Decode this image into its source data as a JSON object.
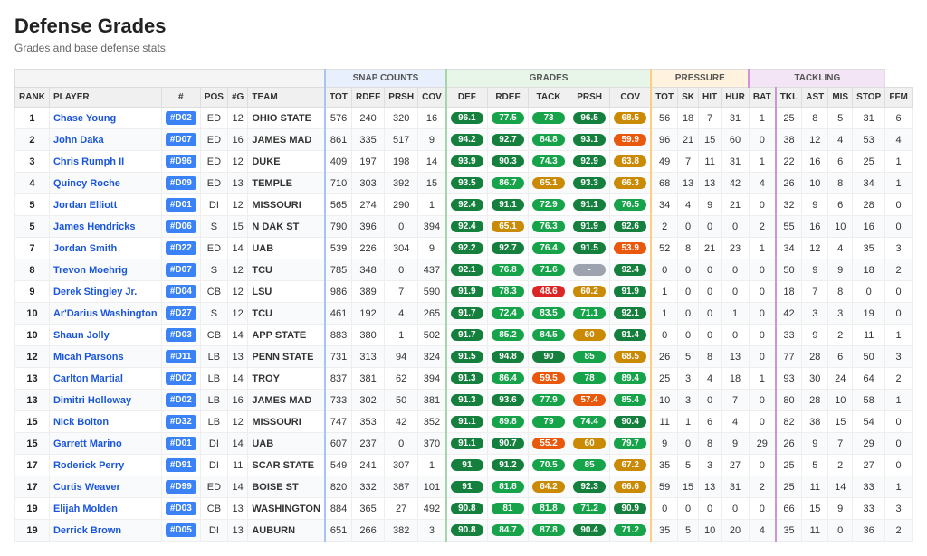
{
  "title": "Defense Grades",
  "subtitle": "Grades and base defense stats.",
  "group_headers": [
    {
      "label": "",
      "colspan": 5,
      "key": "empty1"
    },
    {
      "label": "SNAP COUNTS",
      "colspan": 4,
      "key": "snap"
    },
    {
      "label": "GRADES",
      "colspan": 5,
      "key": "grades"
    },
    {
      "label": "PRESSURE",
      "colspan": 4,
      "key": "pressure"
    },
    {
      "label": "TACKLING",
      "colspan": 5,
      "key": "tackling"
    }
  ],
  "col_headers": [
    "RANK",
    "PLAYER",
    "#",
    "POS",
    "#G",
    "TEAM",
    "TOT",
    "RDEF",
    "PRSH",
    "COV",
    "DEF",
    "RDEF",
    "TACK",
    "PRSH",
    "COV",
    "TOT",
    "SK",
    "HIT",
    "HUR",
    "BAT",
    "TKL",
    "AST",
    "MIS",
    "STOP",
    "FFM"
  ],
  "rows": [
    {
      "rank": 1,
      "player": "Chase Young",
      "num": "#D02",
      "pos": "ED",
      "g": 12,
      "team": "OHIO STATE",
      "tot": 576,
      "rdef": 240,
      "prsh": 320,
      "cov": 16,
      "def": 96.1,
      "def_c": "g-green-dark",
      "rdef_g": 77.5,
      "rdef_c": "g-green",
      "tack_g": 73.0,
      "tack_c": "g-green",
      "prsh_g": 96.5,
      "prsh_c": "g-green-dark",
      "cov_g": 68.5,
      "cov_c": "g-yellow",
      "ptot": 56,
      "sk": 18,
      "hit": 7,
      "hur": 31,
      "bat": 1,
      "tkl": 25,
      "ast": 8,
      "mis": 5,
      "stop": 31,
      "ffm": 6
    },
    {
      "rank": 2,
      "player": "John Daka",
      "num": "#D07",
      "pos": "ED",
      "g": 16,
      "team": "JAMES MAD",
      "tot": 861,
      "rdef": 335,
      "prsh": 517,
      "cov": 9,
      "def": 94.2,
      "def_c": "g-green-dark",
      "rdef_g": 92.7,
      "rdef_c": "g-green-dark",
      "tack_g": 84.8,
      "tack_c": "g-green",
      "prsh_g": 93.1,
      "prsh_c": "g-green-dark",
      "cov_g": 59.9,
      "cov_c": "g-orange",
      "ptot": 96,
      "sk": 21,
      "hit": 15,
      "hur": 60,
      "bat": 0,
      "tkl": 38,
      "ast": 12,
      "mis": 4,
      "stop": 53,
      "ffm": 4
    },
    {
      "rank": 3,
      "player": "Chris Rumph II",
      "num": "#D96",
      "pos": "ED",
      "g": 12,
      "team": "DUKE",
      "tot": 409,
      "rdef": 197,
      "prsh": 198,
      "cov": 14,
      "def": 93.9,
      "def_c": "g-green-dark",
      "rdef_g": 90.3,
      "rdef_c": "g-green-dark",
      "tack_g": 74.3,
      "tack_c": "g-green",
      "prsh_g": 92.9,
      "prsh_c": "g-green-dark",
      "cov_g": 63.8,
      "cov_c": "g-yellow",
      "ptot": 49,
      "sk": 7,
      "hit": 11,
      "hur": 31,
      "bat": 1,
      "tkl": 22,
      "ast": 16,
      "mis": 6,
      "stop": 25,
      "ffm": 1
    },
    {
      "rank": 4,
      "player": "Quincy Roche",
      "num": "#D09",
      "pos": "ED",
      "g": 13,
      "team": "TEMPLE",
      "tot": 710,
      "rdef": 303,
      "prsh": 392,
      "cov": 15,
      "def": 93.5,
      "def_c": "g-green-dark",
      "rdef_g": 86.7,
      "rdef_c": "g-green",
      "tack_g": 65.1,
      "tack_c": "g-yellow",
      "prsh_g": 93.3,
      "prsh_c": "g-green-dark",
      "cov_g": 66.3,
      "cov_c": "g-yellow",
      "ptot": 68,
      "sk": 13,
      "hit": 13,
      "hur": 42,
      "bat": 4,
      "tkl": 26,
      "ast": 10,
      "mis": 8,
      "stop": 34,
      "ffm": 1
    },
    {
      "rank": 5,
      "player": "Jordan Elliott",
      "num": "#D01",
      "pos": "DI",
      "g": 12,
      "team": "MISSOURI",
      "tot": 565,
      "rdef": 274,
      "prsh": 290,
      "cov": 1,
      "def": 92.4,
      "def_c": "g-green-dark",
      "rdef_g": 91.1,
      "rdef_c": "g-green-dark",
      "tack_g": 72.9,
      "tack_c": "g-green",
      "prsh_g": 91.1,
      "prsh_c": "g-green-dark",
      "cov_g": 76.5,
      "cov_c": "g-green",
      "ptot": 34,
      "sk": 4,
      "hit": 9,
      "hur": 21,
      "bat": 0,
      "tkl": 32,
      "ast": 9,
      "mis": 6,
      "stop": 28,
      "ffm": 0
    },
    {
      "rank": 5,
      "player": "James Hendricks",
      "num": "#D06",
      "pos": "S",
      "g": 15,
      "team": "N DAK ST",
      "tot": 790,
      "rdef": 396,
      "prsh": 0,
      "cov": 394,
      "def": 92.4,
      "def_c": "g-green-dark",
      "rdef_g": 65.1,
      "rdef_c": "g-yellow",
      "tack_g": 76.3,
      "tack_c": "g-green",
      "prsh_g": 91.9,
      "prsh_c": "g-green-dark",
      "cov_g": 92.6,
      "cov_c": "g-green-dark",
      "ptot": 2,
      "sk": 0,
      "hit": 0,
      "hur": 0,
      "bat": 2,
      "tkl": 55,
      "ast": 16,
      "mis": 10,
      "stop": 16,
      "ffm": 0
    },
    {
      "rank": 7,
      "player": "Jordan Smith",
      "num": "#D22",
      "pos": "ED",
      "g": 14,
      "team": "UAB",
      "tot": 539,
      "rdef": 226,
      "prsh": 304,
      "cov": 9,
      "def": 92.2,
      "def_c": "g-green-dark",
      "rdef_g": 92.7,
      "rdef_c": "g-green-dark",
      "tack_g": 76.4,
      "tack_c": "g-green",
      "prsh_g": 91.5,
      "prsh_c": "g-green-dark",
      "cov_g": 53.9,
      "cov_c": "g-orange",
      "ptot": 52,
      "sk": 8,
      "hit": 21,
      "hur": 23,
      "bat": 1,
      "tkl": 34,
      "ast": 12,
      "mis": 4,
      "stop": 35,
      "ffm": 3
    },
    {
      "rank": 8,
      "player": "Trevon Moehrig",
      "num": "#D07",
      "pos": "S",
      "g": 12,
      "team": "TCU",
      "tot": 785,
      "rdef": 348,
      "prsh": 0,
      "cov": 437,
      "def": 92.1,
      "def_c": "g-green-dark",
      "rdef_g": 76.8,
      "rdef_c": "g-green",
      "tack_g": 71.6,
      "tack_c": "g-green",
      "prsh_g": "-",
      "prsh_c": "g-gray",
      "cov_g": 92.4,
      "cov_c": "g-green-dark",
      "ptot": 0,
      "sk": 0,
      "hit": 0,
      "hur": 0,
      "bat": 0,
      "tkl": 50,
      "ast": 9,
      "mis": 9,
      "stop": 18,
      "ffm": 2
    },
    {
      "rank": 9,
      "player": "Derek Stingley Jr.",
      "num": "#D04",
      "pos": "CB",
      "g": 12,
      "team": "LSU",
      "tot": 986,
      "rdef": 389,
      "prsh": 7,
      "cov": 590,
      "def": 91.9,
      "def_c": "g-green-dark",
      "rdef_g": 78.3,
      "rdef_c": "g-green",
      "tack_g": 48.6,
      "tack_c": "g-red",
      "prsh_g": 60.2,
      "prsh_c": "g-yellow",
      "cov_g": 91.9,
      "cov_c": "g-green-dark",
      "ptot": 1,
      "sk": 0,
      "hit": 0,
      "hur": 0,
      "bat": 0,
      "tkl": 18,
      "ast": 7,
      "mis": 8,
      "stop": 0,
      "ffm": 0
    },
    {
      "rank": 10,
      "player": "Ar'Darius Washington",
      "num": "#D27",
      "pos": "S",
      "g": 12,
      "team": "TCU",
      "tot": 461,
      "rdef": 192,
      "prsh": 4,
      "cov": 265,
      "def": 91.7,
      "def_c": "g-green-dark",
      "rdef_g": 72.4,
      "rdef_c": "g-green",
      "tack_g": 83.5,
      "tack_c": "g-green",
      "prsh_g": 71.1,
      "prsh_c": "g-green",
      "cov_g": 92.1,
      "cov_c": "g-green-dark",
      "ptot": 1,
      "sk": 0,
      "hit": 0,
      "hur": 1,
      "bat": 0,
      "tkl": 42,
      "ast": 3,
      "mis": 3,
      "stop": 19,
      "ffm": 0
    },
    {
      "rank": 10,
      "player": "Shaun Jolly",
      "num": "#D03",
      "pos": "CB",
      "g": 14,
      "team": "APP STATE",
      "tot": 883,
      "rdef": 380,
      "prsh": 1,
      "cov": 502,
      "def": 91.7,
      "def_c": "g-green-dark",
      "rdef_g": 85.2,
      "rdef_c": "g-green",
      "tack_g": 84.5,
      "tack_c": "g-green",
      "prsh_g": 60.0,
      "prsh_c": "g-yellow",
      "cov_g": 91.4,
      "cov_c": "g-green-dark",
      "ptot": 0,
      "sk": 0,
      "hit": 0,
      "hur": 0,
      "bat": 0,
      "tkl": 33,
      "ast": 9,
      "mis": 2,
      "stop": 11,
      "ffm": 1
    },
    {
      "rank": 12,
      "player": "Micah Parsons",
      "num": "#D11",
      "pos": "LB",
      "g": 13,
      "team": "PENN STATE",
      "tot": 731,
      "rdef": 313,
      "prsh": 94,
      "cov": 324,
      "def": 91.5,
      "def_c": "g-green-dark",
      "rdef_g": 94.8,
      "rdef_c": "g-green-dark",
      "tack_g": 90.0,
      "tack_c": "g-green-dark",
      "prsh_g": 85.0,
      "prsh_c": "g-green",
      "cov_g": 68.5,
      "cov_c": "g-yellow",
      "ptot": 26,
      "sk": 5,
      "hit": 8,
      "hur": 13,
      "bat": 0,
      "tkl": 77,
      "ast": 28,
      "mis": 6,
      "stop": 50,
      "ffm": 3
    },
    {
      "rank": 13,
      "player": "Carlton Martial",
      "num": "#D02",
      "pos": "LB",
      "g": 14,
      "team": "TROY",
      "tot": 837,
      "rdef": 381,
      "prsh": 62,
      "cov": 394,
      "def": 91.3,
      "def_c": "g-green-dark",
      "rdef_g": 86.4,
      "rdef_c": "g-green",
      "tack_g": 59.5,
      "tack_c": "g-orange",
      "prsh_g": 78.0,
      "prsh_c": "g-green",
      "cov_g": 89.4,
      "cov_c": "g-green",
      "ptot": 25,
      "sk": 3,
      "hit": 4,
      "hur": 18,
      "bat": 1,
      "tkl": 93,
      "ast": 30,
      "mis": 24,
      "stop": 64,
      "ffm": 2
    },
    {
      "rank": 13,
      "player": "Dimitri Holloway",
      "num": "#D02",
      "pos": "LB",
      "g": 16,
      "team": "JAMES MAD",
      "tot": 733,
      "rdef": 302,
      "prsh": 50,
      "cov": 381,
      "def": 91.3,
      "def_c": "g-green-dark",
      "rdef_g": 93.6,
      "rdef_c": "g-green-dark",
      "tack_g": 77.9,
      "tack_c": "g-green",
      "prsh_g": 57.4,
      "prsh_c": "g-orange",
      "cov_g": 85.4,
      "cov_c": "g-green",
      "ptot": 10,
      "sk": 3,
      "hit": 0,
      "hur": 7,
      "bat": 0,
      "tkl": 80,
      "ast": 28,
      "mis": 10,
      "stop": 58,
      "ffm": 1
    },
    {
      "rank": 15,
      "player": "Nick Bolton",
      "num": "#D32",
      "pos": "LB",
      "g": 12,
      "team": "MISSOURI",
      "tot": 747,
      "rdef": 353,
      "prsh": 42,
      "cov": 352,
      "def": 91.1,
      "def_c": "g-green-dark",
      "rdef_g": 89.8,
      "rdef_c": "g-green",
      "tack_g": 79.0,
      "tack_c": "g-green",
      "prsh_g": 74.4,
      "prsh_c": "g-green",
      "cov_g": 90.4,
      "cov_c": "g-green-dark",
      "ptot": 11,
      "sk": 1,
      "hit": 6,
      "hur": 4,
      "bat": 0,
      "tkl": 82,
      "ast": 38,
      "mis": 15,
      "stop": 54,
      "ffm": 0
    },
    {
      "rank": 15,
      "player": "Garrett Marino",
      "num": "#D01",
      "pos": "DI",
      "g": 14,
      "team": "UAB",
      "tot": 607,
      "rdef": 237,
      "prsh": 0,
      "cov": 370,
      "def": 91.1,
      "def_c": "g-green-dark",
      "rdef_g": 90.7,
      "rdef_c": "g-green-dark",
      "tack_g": 55.2,
      "tack_c": "g-orange",
      "prsh_g": 60.0,
      "prsh_c": "g-yellow",
      "cov_g": 79.7,
      "cov_c": "g-green",
      "ptot": 9,
      "sk": 0,
      "hit": 8,
      "hur": 9,
      "bat": 29,
      "tkl": 26,
      "ast": 9,
      "mis": 7,
      "stop": 29,
      "ffm": 0
    },
    {
      "rank": 17,
      "player": "Roderick Perry",
      "num": "#D91",
      "pos": "DI",
      "g": 11,
      "team": "SCAR STATE",
      "tot": 549,
      "rdef": 241,
      "prsh": 307,
      "cov": 1,
      "def": 91.0,
      "def_c": "g-green-dark",
      "rdef_g": 91.2,
      "rdef_c": "g-green-dark",
      "tack_g": 70.5,
      "tack_c": "g-green",
      "prsh_g": 85.0,
      "prsh_c": "g-green",
      "cov_g": 67.2,
      "cov_c": "g-yellow",
      "ptot": 35,
      "sk": 5,
      "hit": 3,
      "hur": 27,
      "bat": 0,
      "tkl": 25,
      "ast": 5,
      "mis": 2,
      "stop": 27,
      "ffm": 0
    },
    {
      "rank": 17,
      "player": "Curtis Weaver",
      "num": "#D99",
      "pos": "ED",
      "g": 14,
      "team": "BOISE ST",
      "tot": 820,
      "rdef": 332,
      "prsh": 387,
      "cov": 101,
      "def": 91.0,
      "def_c": "g-green-dark",
      "rdef_g": 81.8,
      "rdef_c": "g-green",
      "tack_g": 64.2,
      "tack_c": "g-yellow",
      "prsh_g": 92.3,
      "prsh_c": "g-green-dark",
      "cov_g": 66.6,
      "cov_c": "g-yellow",
      "ptot": 59,
      "sk": 15,
      "hit": 13,
      "hur": 31,
      "bat": 2,
      "tkl": 25,
      "ast": 11,
      "mis": 14,
      "stop": 33,
      "ffm": 1
    },
    {
      "rank": 19,
      "player": "Elijah Molden",
      "num": "#D03",
      "pos": "CB",
      "g": 13,
      "team": "WASHINGTON",
      "tot": 884,
      "rdef": 365,
      "prsh": 27,
      "cov": 492,
      "def": 90.8,
      "def_c": "g-green-dark",
      "rdef_g": 81.0,
      "rdef_c": "g-green",
      "tack_g": 81.8,
      "tack_c": "g-green",
      "prsh_g": 71.2,
      "prsh_c": "g-green",
      "cov_g": 90.9,
      "cov_c": "g-green-dark",
      "ptot": 0,
      "sk": 0,
      "hit": 0,
      "hur": 0,
      "bat": 0,
      "tkl": 66,
      "ast": 15,
      "mis": 9,
      "stop": 33,
      "ffm": 3
    },
    {
      "rank": 19,
      "player": "Derrick Brown",
      "num": "#D05",
      "pos": "DI",
      "g": 13,
      "team": "AUBURN",
      "tot": 651,
      "rdef": 266,
      "prsh": 382,
      "cov": 3,
      "def": 90.8,
      "def_c": "g-green-dark",
      "rdef_g": 84.7,
      "rdef_c": "g-green",
      "tack_g": 87.8,
      "tack_c": "g-green",
      "prsh_g": 90.4,
      "prsh_c": "g-green-dark",
      "cov_g": 71.2,
      "cov_c": "g-green",
      "ptot": 35,
      "sk": 5,
      "hit": 10,
      "hur": 20,
      "bat": 4,
      "tkl": 35,
      "ast": 11,
      "mis": 0,
      "stop": 36,
      "ffm": 2
    }
  ]
}
